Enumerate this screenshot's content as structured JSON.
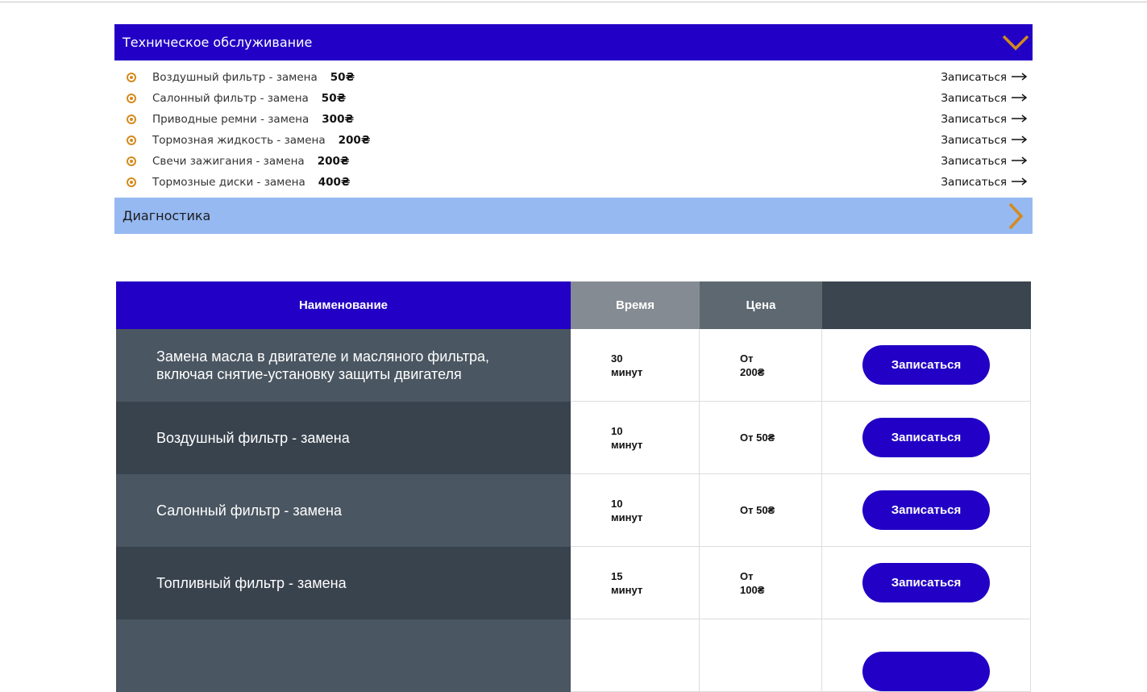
{
  "accordion": {
    "section1": {
      "title": "Техническое обслуживание",
      "items": [
        {
          "name": "Воздушный фильтр - замена",
          "price": "50₴",
          "link": "Записаться"
        },
        {
          "name": "Салонный фильтр - замена",
          "price": "50₴",
          "link": "Записаться"
        },
        {
          "name": "Приводные ремни - замена",
          "price": "300₴",
          "link": "Записаться"
        },
        {
          "name": "Тормозная жидкость - замена",
          "price": "200₴",
          "link": "Записаться"
        },
        {
          "name": "Свечи зажигания - замена",
          "price": "200₴",
          "link": "Записаться"
        },
        {
          "name": "Тормозные диски - замена",
          "price": "400₴",
          "link": "Записаться"
        }
      ]
    },
    "section2": {
      "title": "Диагностика"
    },
    "accent_color": "#d48a1c",
    "open_color": "#2200c5",
    "closed_color": "#96b9f2"
  },
  "table": {
    "headers": {
      "name": "Наименование",
      "time": "Время",
      "price": "Цена",
      "action": ""
    },
    "rows": [
      {
        "name": "Замена масла в двигателе и масляного фильтра,\nвключая снятие-установку защиты двигателя",
        "time": "30\nминут",
        "price": "От\n200₴",
        "button": "Записаться"
      },
      {
        "name": "Воздушный фильтр - замена",
        "time": "10\nминут",
        "price": "От 50₴",
        "button": "Записаться"
      },
      {
        "name": "Салонный фильтр - замена",
        "time": "10\nминут",
        "price": "От 50₴",
        "button": "Записаться"
      },
      {
        "name": "Топливный фильтр - замена",
        "time": "15\nминут",
        "price": "От\n100₴",
        "button": "Записаться"
      }
    ]
  }
}
